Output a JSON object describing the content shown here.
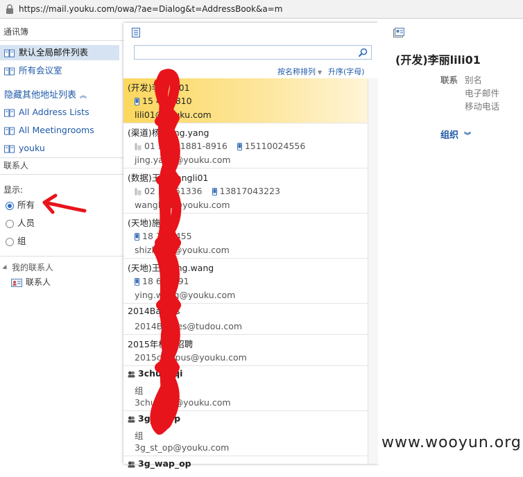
{
  "browser": {
    "url": "https://mail.youku.com/owa/?ae=Dialog&t=AddressBook&a=m"
  },
  "left": {
    "address_book_header": "通讯簿",
    "nav_items": [
      {
        "label": "默认全局邮件列表",
        "selected": true
      },
      {
        "label": "所有会议室",
        "selected": false
      }
    ],
    "hide_other_lists": "隐藏其他地址列表",
    "other_lists": [
      {
        "label": "All Address Lists"
      },
      {
        "label": "All Meetingrooms"
      },
      {
        "label": "youku"
      }
    ],
    "contacts_header": "联系人",
    "show_label": "显示:",
    "filter_options": [
      {
        "label": "所有",
        "checked": true
      },
      {
        "label": "人员",
        "checked": false
      },
      {
        "label": "组",
        "checked": false
      }
    ],
    "my_contacts": "我的联系人",
    "contacts_folder": "联系人"
  },
  "middle": {
    "search": {
      "value": "",
      "placeholder": ""
    },
    "sort_by_label": "按名称排列",
    "sort_order_label": "升序(字母)",
    "entries": [
      {
        "name": "(开发)李丽lili01",
        "lines": [
          "15  4  08810",
          "lili01@youku.com"
        ],
        "selected": true
      },
      {
        "name": "(渠道)杨晶jing.yang",
        "lines": [
          "01  58851881-8916",
          "15110024556",
          "jing.yang@youku.com"
        ]
      },
      {
        "name": "(数据)王莉wangli01",
        "lines": [
          "02  35961336",
          "13817043223",
          "wangli01@youku.com"
        ]
      },
      {
        "name": "(天地)施忠",
        "lines": [
          "18  7 85455",
          "shizhong@youku.com"
        ]
      },
      {
        "name": "(天地)王莹ying.wang",
        "lines": [
          "18  621891",
          "ying.wang@youku.com"
        ]
      },
      {
        "name": "2014Battles",
        "lines": [
          "2014Battles@tudou.com"
        ]
      },
      {
        "name": "2015年校园招聘",
        "lines": [
          "2015campus@youku.com"
        ]
      },
      {
        "name": "3chuanqi",
        "lines": [
          "组",
          "3chuanqi@youku.com"
        ]
      },
      {
        "name": "3g_st_op",
        "lines": [
          "组",
          "3g_st_op@youku.com"
        ]
      },
      {
        "name": "3g_wap_op",
        "lines": []
      }
    ]
  },
  "right": {
    "name": "(开发)李丽lili01",
    "contact_label": "联系",
    "fields": [
      "别名",
      "电子邮件",
      "移动电话"
    ],
    "org_label": "组织"
  },
  "watermark": "www.wooyun.org",
  "colors": {
    "accent": "#1f5aa8",
    "selection": "#fbd75e",
    "redaction": "#e8141b"
  }
}
